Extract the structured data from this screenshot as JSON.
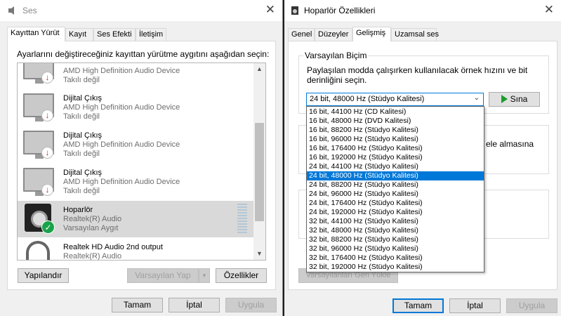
{
  "left_window": {
    "title": "Ses",
    "tabs": [
      "Kayıttan Yürüt",
      "Kayıt",
      "Ses Efekti",
      "İletişim"
    ],
    "instruction": "Ayarlarını değiştireceğiniz kayıttan yürütme aygıtını aşağıdan seçin:",
    "devices": [
      {
        "name": "",
        "line2": "AMD High Definition Audio Device",
        "line3": "Takılı değil"
      },
      {
        "name": "Dijital Çıkış",
        "line2": "AMD High Definition Audio Device",
        "line3": "Takılı değil"
      },
      {
        "name": "Dijital Çıkış",
        "line2": "AMD High Definition Audio Device",
        "line3": "Takılı değil"
      },
      {
        "name": "Dijital Çıkış",
        "line2": "AMD High Definition Audio Device",
        "line3": "Takılı değil"
      },
      {
        "name": "Hoparlör",
        "line2": "Realtek(R) Audio",
        "line3": "Varsayılan Aygıt"
      },
      {
        "name": "Realtek HD Audio 2nd output",
        "line2": "Realtek(R) Audio",
        "line3": ""
      }
    ],
    "buttons": {
      "configure": "Yapılandır",
      "set_default": "Varsayılan Yap",
      "properties": "Özellikler",
      "ok": "Tamam",
      "cancel": "İptal",
      "apply": "Uygula"
    }
  },
  "right_window": {
    "title": "Hoparlör Özellikleri",
    "tabs": [
      "Genel",
      "Düzeyler",
      "Gelişmiş",
      "Uzamsal ses"
    ],
    "default_format": {
      "group_title": "Varsayılan Biçim",
      "description": "Paylaşılan modda çalışırken kullanılacak örnek hızını ve bit derinliğini seçin.",
      "selected": "24 bit, 48000 Hz (Stüdyo Kalitesi)",
      "test_button": "Sına",
      "options": [
        "16 bit, 44100 Hz (CD Kalitesi)",
        "16 bit, 48000 Hz (DVD Kalitesi)",
        "16 bit, 88200 Hz (Stüdyo Kalitesi)",
        "16 bit, 96000 Hz (Stüdyo Kalitesi)",
        "16 bit, 176400 Hz (Stüdyo Kalitesi)",
        "16 bit, 192000 Hz (Stüdyo Kalitesi)",
        "24 bit, 44100 Hz (Stüdyo Kalitesi)",
        "24 bit, 48000 Hz (Stüdyo Kalitesi)",
        "24 bit, 88200 Hz (Stüdyo Kalitesi)",
        "24 bit, 96000 Hz (Stüdyo Kalitesi)",
        "24 bit, 176400 Hz (Stüdyo Kalitesi)",
        "24 bit, 192000 Hz (Stüdyo Kalitesi)",
        "32 bit, 44100 Hz (Stüdyo Kalitesi)",
        "32 bit, 48000 Hz (Stüdyo Kalitesi)",
        "32 bit, 88200 Hz (Stüdyo Kalitesi)",
        "32 bit, 96000 Hz (Stüdyo Kalitesi)",
        "32 bit, 176400 Hz (Stüdyo Kalitesi)",
        "32 bit, 192000 Hz (Stüdyo Kalitesi)"
      ],
      "highlighted_index": 7
    },
    "partial_texts": {
      "exclusive_tail": "ele almasına",
      "restore_defaults": "Varsayılanları Geri Yükle"
    },
    "buttons": {
      "ok": "Tamam",
      "cancel": "İptal",
      "apply": "Uygula"
    }
  },
  "colors": {
    "accent": "#0078d7",
    "check_green": "#18a34a",
    "error_red": "#d21"
  }
}
